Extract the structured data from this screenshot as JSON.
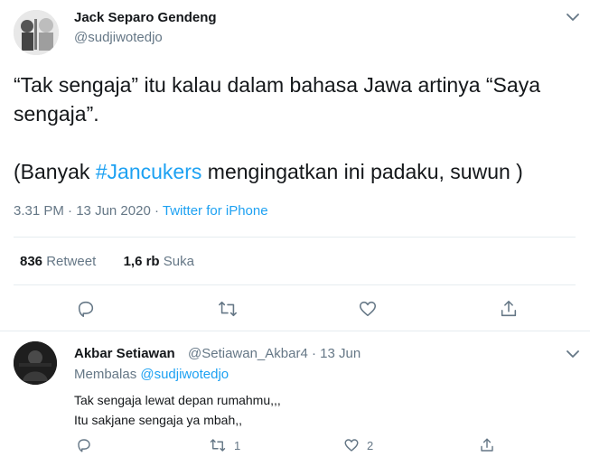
{
  "tweet": {
    "author_name": "Jack Separo Gendeng",
    "author_handle": "@sudjiwotedjo",
    "text_line1": "“Tak sengaja” itu kalau dalam bahasa Jawa artinya “Saya",
    "text_line2": "sengaja”.",
    "text_line3_prefix": "(Banyak ",
    "hashtag": "#Jancukers",
    "text_line3_suffix": " mengingatkan ini padaku, suwun )",
    "time": "3.31 PM",
    "dot1": " · ",
    "date": "13 Jun 2020",
    "dot2": " · ",
    "source": "Twitter for iPhone",
    "retweets_count": "836",
    "retweets_label": "Retweet",
    "likes_count": "1,6 rb",
    "likes_label": "Suka"
  },
  "reply": {
    "author_name": "Akbar Setiawan",
    "author_handle": "@Setiawan_Akbar4",
    "dot": " · ",
    "date": "13 Jun",
    "replying_prefix": "Membalas ",
    "replying_to": "@sudjiwotedjo",
    "text_line1": "Tak sengaja lewat depan rumahmu,,,",
    "text_line2": "Itu sakjane sengaja ya mbah,,",
    "retweet_count": "1",
    "like_count": "2"
  },
  "colors": {
    "accent": "#1da1f2",
    "secondary_text": "#657786",
    "primary_text": "#14171a",
    "divider": "#e6ecf0"
  },
  "icons": {
    "reply": "reply-icon",
    "retweet": "retweet-icon",
    "like": "heart-icon",
    "share": "share-icon",
    "more": "chevron-down-icon"
  }
}
